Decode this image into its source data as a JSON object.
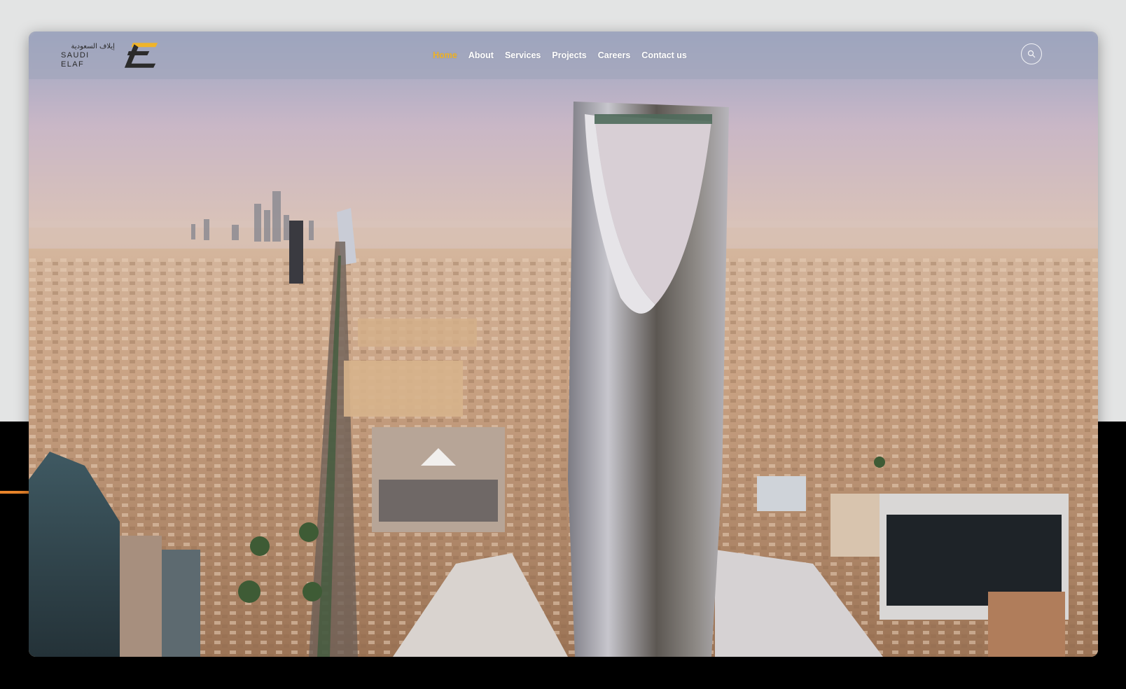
{
  "brand": {
    "name_ar": "إيلاف السعودية",
    "name_en": "SAUDI ELAF",
    "logo_icon": "elaf-e-logo-icon",
    "accent_color": "#f0b429"
  },
  "nav": {
    "items": [
      {
        "label": "Home",
        "active": true
      },
      {
        "label": "About",
        "active": false
      },
      {
        "label": "Services",
        "active": false
      },
      {
        "label": "Projects",
        "active": false
      },
      {
        "label": "Careers",
        "active": false
      },
      {
        "label": "Contact us",
        "active": false
      }
    ],
    "active_color": "#f0b429",
    "search_icon": "search-icon"
  },
  "hero": {
    "image": "riyadh-skyline-kingdom-tower-aerial"
  },
  "colors": {
    "page_top": "#e3e4e4",
    "page_bottom": "#000000",
    "accent_line": "#e8842a"
  }
}
